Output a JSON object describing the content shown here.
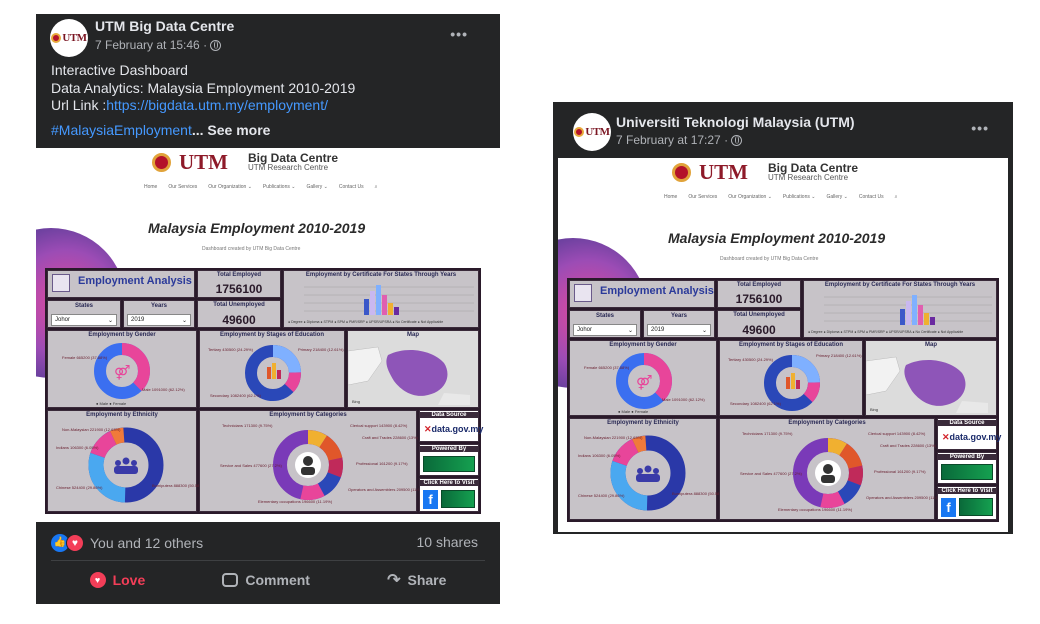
{
  "posts": [
    {
      "page_name": "UTM Big Data Centre",
      "timestamp": "7 February at 15:46 ·",
      "avatar_text": "UTM",
      "more_label": "•••",
      "text_lines": [
        "Interactive Dashboard",
        "Data Analytics: Malaysia Employment 2010-2019"
      ],
      "url_prefix": "Url Link :",
      "url": "https://bigdata.utm.my/employment/",
      "hashtag": "#MalaysiaEmployment",
      "see_more": "... See more",
      "reactions_text": "You and 12 others",
      "shares": "10 shares",
      "actions": {
        "love": "Love",
        "comment": "Comment",
        "share": "Share"
      }
    },
    {
      "page_name": "Universiti Teknologi Malaysia (UTM)",
      "timestamp": "7 February at 17:27 ·",
      "avatar_text": "UTM",
      "more_label": "•••"
    }
  ],
  "dashboard": {
    "logo_text": "UTM",
    "centre_title": "Big Data Centre",
    "centre_sub": "UTM Research Centre",
    "nav": [
      "Home",
      "Our Services",
      "Our Organization ⌄",
      "Publications ⌄",
      "Gallery ⌄",
      "Contact Us"
    ],
    "title": "Malaysia Employment 2010-2019",
    "subtitle": "Dashboard created by UTM Big Data Centre",
    "panels": {
      "employment_analysis": "Employment Analysis",
      "total_employed_label": "Total Employed",
      "total_employed": "1756100",
      "total_unemployed_label": "Total Unemployed",
      "total_unemployed": "49600",
      "states_label": "States",
      "states_value": "Johor",
      "years_label": "Years",
      "years_value": "2019",
      "certificate_title": "Employment by Certificate For States Through Years",
      "gender_title": "Employment by Gender",
      "gender_female": "Female 665200 (37.88%)",
      "gender_male": "Male 1091000 (62.12%)",
      "gender_legend": "● Male ● Female",
      "education_title": "Employment by Stages of Education",
      "edu_tertiary": "Tertiary 430500 (24.29%)",
      "edu_primary": "Primary 218400 (12.61%)",
      "edu_secondary": "Secondary 1082400 (62.1%)",
      "map_title": "Map",
      "map_credit": "Bing",
      "ethnicity_title": "Employment by Ethnicity",
      "eth_non_malaysian": "Non-Malaysian 221900 (12.63%)",
      "eth_indians": "Indians 106300 (6.05%)",
      "eth_chinese": "Chinese 524400 (29.86%)",
      "eth_bumiputera": "Bumiputera 888300 (50.58%)",
      "categories_title": "Employment by Categories",
      "cat_technicians": "Technicians 171300 (9.75%)",
      "cat_clerical": "Clerical support 143900 (8.42%)",
      "cat_craft": "Craft and Trades 228600 (13%)",
      "cat_service": "Service and Sales 477600 (27.2%)",
      "cat_professional": "Professional 161200 (9.17%)",
      "cat_operators": "Operators and Assemblers 209500 (11.9%)",
      "cat_elementary": "Elementary occupations 196600 (11.19%)",
      "data_source_label": "Data Source",
      "datagov_text": "data.gov.my",
      "powered_label": "Powered By",
      "click_label": "Click Here to Visit"
    }
  },
  "colors": {
    "fb_dark": "#242526",
    "fb_text": "#e4e6eb",
    "fb_link": "#4599ff",
    "love": "#f33e58",
    "like": "#1877f2",
    "utm_maroon": "#8e1a29"
  }
}
